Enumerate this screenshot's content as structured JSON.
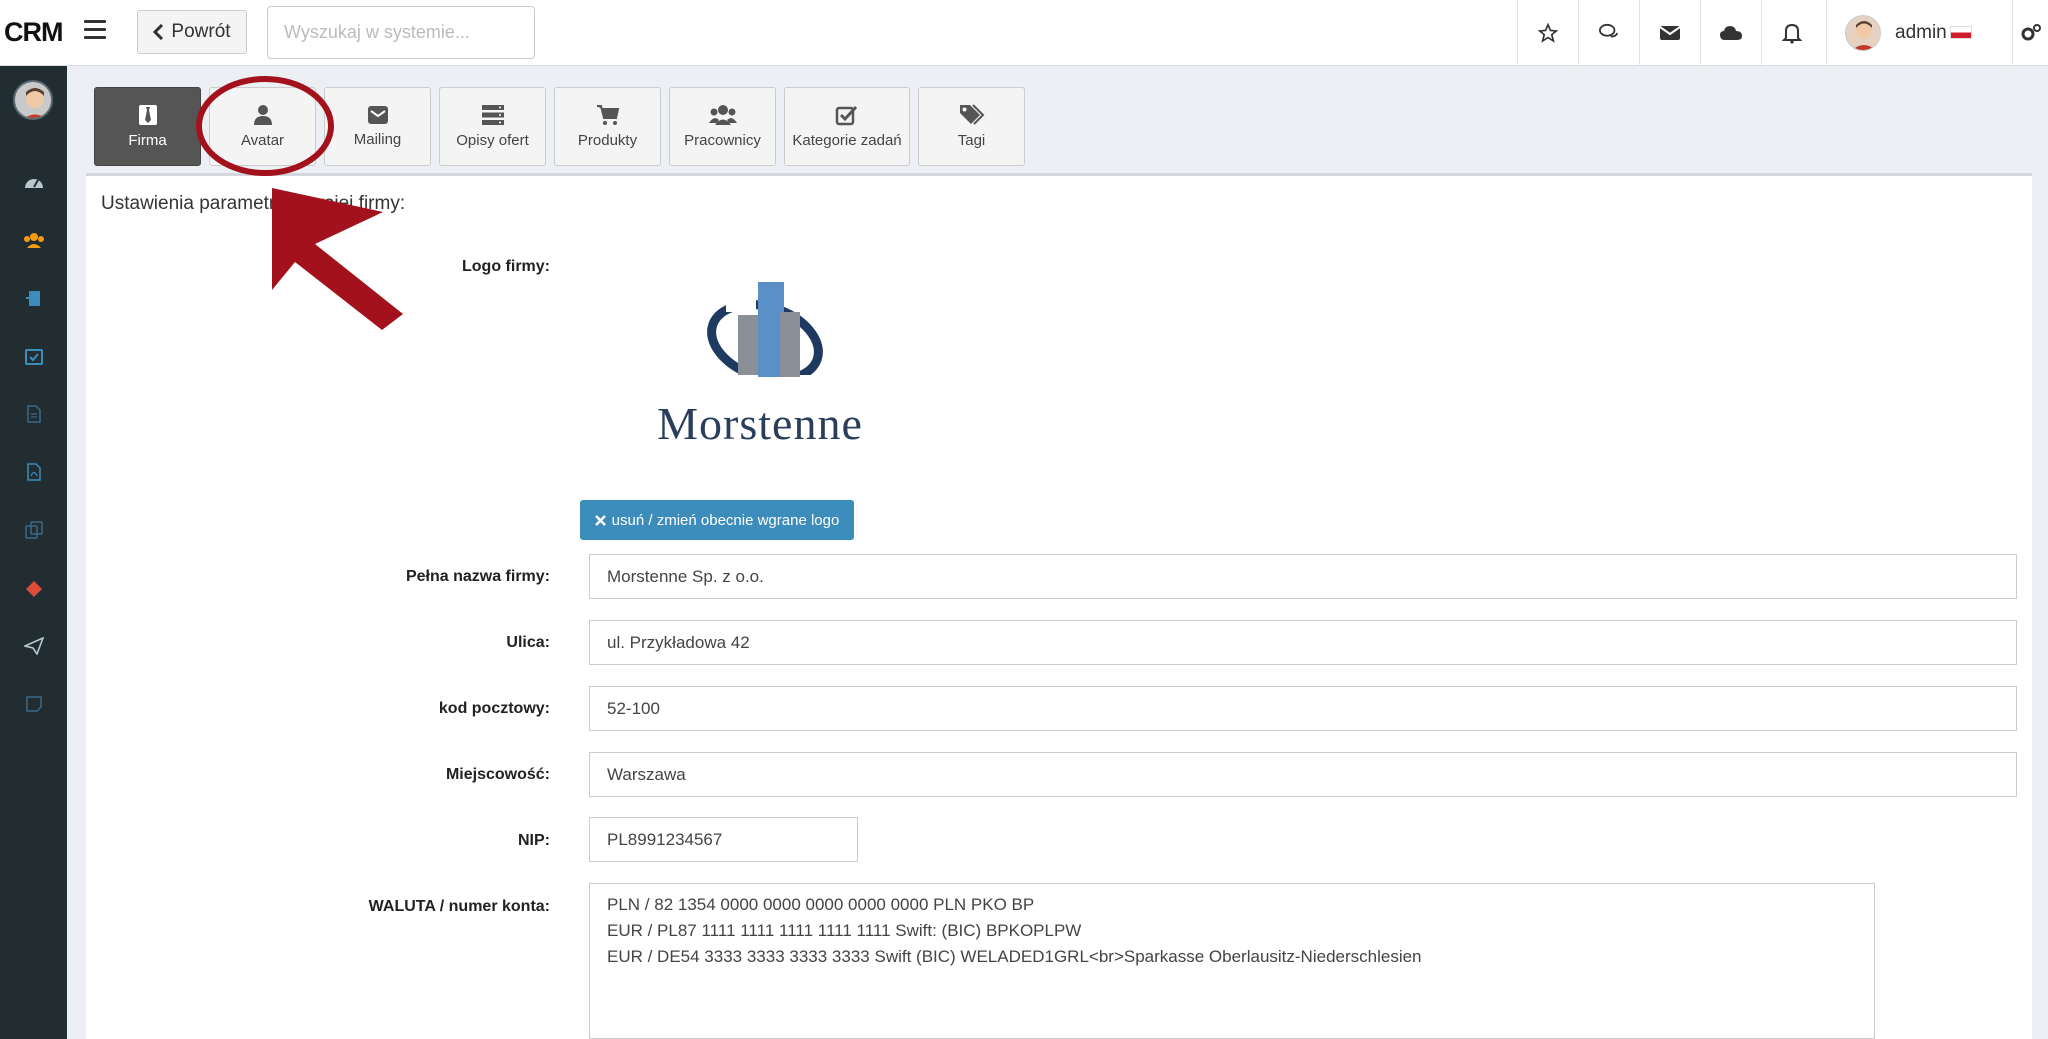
{
  "app": {
    "brand": "CRM",
    "back_label": "Powrót",
    "search_placeholder": "Wyszukaj w systemie...",
    "user_name": "admin"
  },
  "tabs": [
    {
      "label": "Firma",
      "icon": "tie-icon",
      "active": true
    },
    {
      "label": "Avatar",
      "icon": "user-icon",
      "active": false
    },
    {
      "label": "Mailing",
      "icon": "envelope-icon",
      "active": false
    },
    {
      "label": "Opisy ofert",
      "icon": "server-icon",
      "active": false
    },
    {
      "label": "Produkty",
      "icon": "cart-icon",
      "active": false
    },
    {
      "label": "Pracownicy",
      "icon": "users-icon",
      "active": false
    },
    {
      "label": "Kategorie zadań",
      "icon": "check-square-icon",
      "active": false
    },
    {
      "label": "Tagi",
      "icon": "tags-icon",
      "active": false
    }
  ],
  "form": {
    "section_title": "Ustawienia parametrów twojej firmy:",
    "logo_label": "Logo firmy:",
    "logo_text": "Morstenne",
    "logo_button": "usuń / zmień obecnie wgrane logo",
    "full_name_label": "Pełna nazwa firmy:",
    "full_name_value": "Morstenne Sp. z o.o.",
    "street_label": "Ulica:",
    "street_value": "ul. Przykładowa 42",
    "postal_label": "kod pocztowy:",
    "postal_value": "52-100",
    "city_label": "Miejscowość:",
    "city_value": "Warszawa",
    "nip_label": "NIP:",
    "nip_value": "PL8991234567",
    "currency_label": "WALUTA / numer konta:",
    "currency_lines": [
      "PLN / 82 1354 0000 0000 0000 0000 0000 PLN PKO BP",
      "EUR / PL87 1111 1111 1111 1111 1111 Swift: (BIC) BPKOPLPW",
      "EUR / DE54 3333 3333 3333 3333 Swift (BIC) WELADED1GRL<br>Sparkasse Oberlausitz-Niederschlesien"
    ]
  },
  "colors": {
    "sidebar": "#222d32",
    "primary_button": "#3c8dbc",
    "annotation": "#a3121c"
  }
}
